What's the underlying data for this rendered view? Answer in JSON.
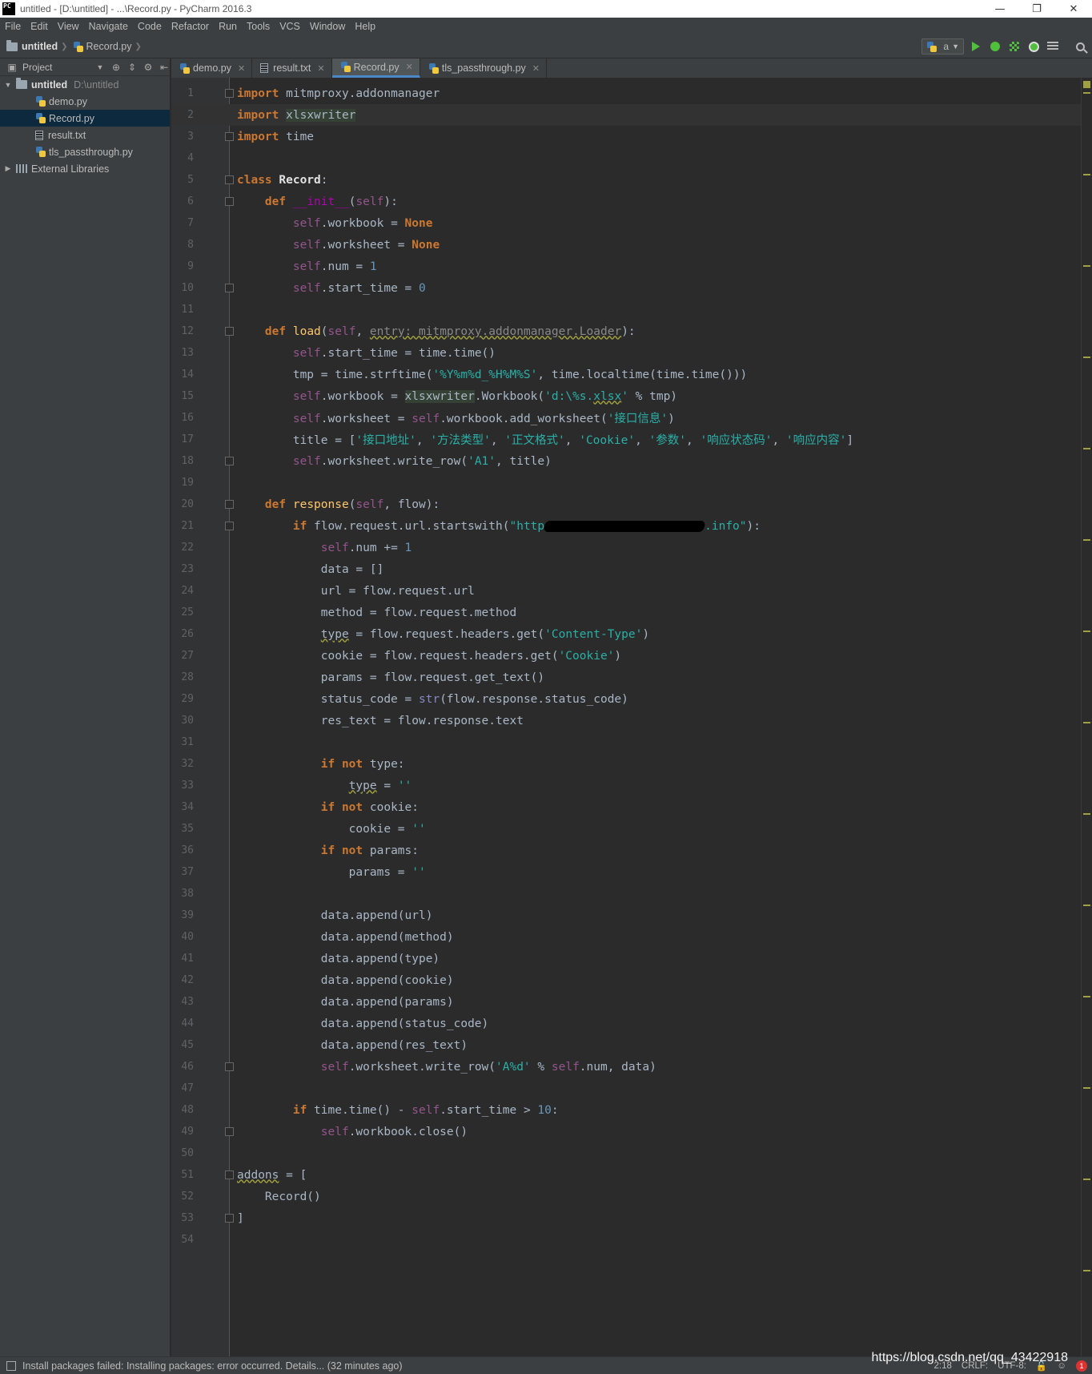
{
  "window": {
    "logo": "PC",
    "title": "untitled - [D:\\untitled] - ...\\Record.py - PyCharm 2016.3",
    "minimize": "—",
    "restore": "❐",
    "close": "✕"
  },
  "menu": [
    "File",
    "Edit",
    "View",
    "Navigate",
    "Code",
    "Refactor",
    "Run",
    "Tools",
    "VCS",
    "Window",
    "Help"
  ],
  "navbar": {
    "project": "untitled",
    "file": "Record.py",
    "run_config": "a"
  },
  "project_panel": {
    "title": "Project",
    "root": {
      "name": "untitled",
      "path": "D:\\untitled"
    },
    "files": [
      "demo.py",
      "Record.py",
      "result.txt",
      "tls_passthrough.py"
    ],
    "external": "External Libraries",
    "selected": "Record.py"
  },
  "tabs": [
    {
      "label": "demo.py",
      "kind": "py"
    },
    {
      "label": "result.txt",
      "kind": "txt"
    },
    {
      "label": "Record.py",
      "kind": "py",
      "active": true
    },
    {
      "label": "tls_passthrough.py",
      "kind": "py"
    }
  ],
  "editor": {
    "current_line": 2,
    "line_numbers": [
      "1",
      "2",
      "3",
      "4",
      "5",
      "6",
      "7",
      "8",
      "9",
      "10",
      "11",
      "12",
      "13",
      "14",
      "15",
      "16",
      "17",
      "18",
      "19",
      "20",
      "21",
      "22",
      "23",
      "24",
      "25",
      "26",
      "27",
      "28",
      "29",
      "30",
      "31",
      "32",
      "33",
      "34",
      "35",
      "36",
      "37",
      "38",
      "39",
      "40",
      "41",
      "42",
      "43",
      "44",
      "45",
      "46",
      "47",
      "48",
      "49",
      "50",
      "51",
      "52",
      "53",
      "54"
    ]
  },
  "status": {
    "message": "Install packages failed: Installing packages: error occurred. Details... (32 minutes ago)",
    "position": "2:18",
    "line_sep": "CRLF:",
    "encoding": "UTF-8:",
    "errors": "1"
  },
  "watermark": "https://blog.csdn.net/qq_43422918"
}
